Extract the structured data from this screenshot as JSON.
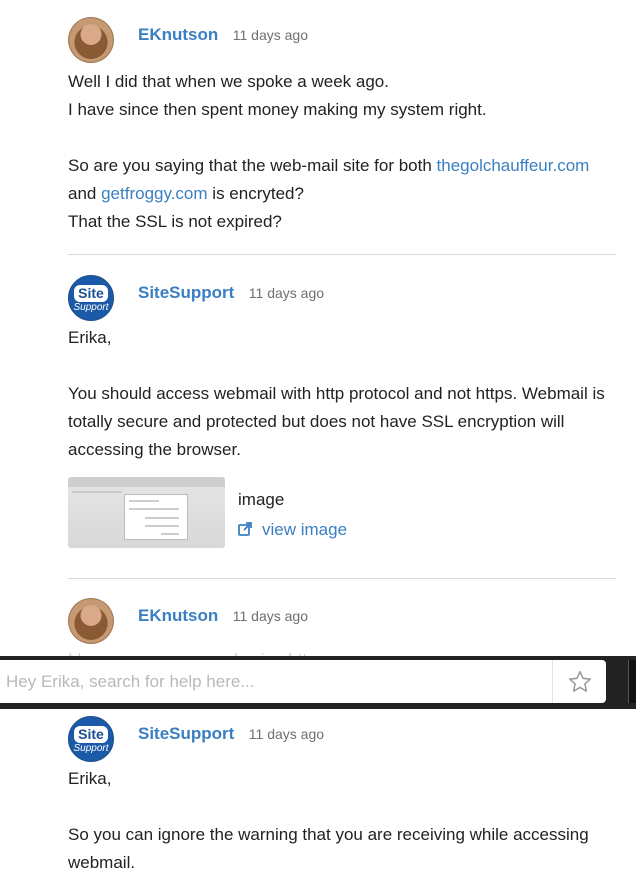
{
  "comments": [
    {
      "author": "EKnutson",
      "time": "11 days ago",
      "avatar": "user-photo",
      "lines": [
        "Well I did that when we spoke a week ago.",
        "I have since then spent money making my system right."
      ],
      "line3_prefix": "So are you saying that the web-mail site for both ",
      "line3_link": "thegolchauffeur.com",
      "line4_prefix": "and ",
      "line4_link": "getfroggy.com",
      "line4_suffix": " is encryted?",
      "line5": "That the SSL is not expired?"
    },
    {
      "author": "SiteSupport",
      "time": "11 days ago",
      "avatar_top": "Site",
      "avatar_bottom": "Support",
      "greeting": "Erika,",
      "paragraph": "You should access webmail with http protocol and not https. Webmail is totally secure and protected but does not have SSL encryption will accessing the browser.",
      "attachment": {
        "name": "image",
        "view_label": "view image"
      }
    },
    {
      "author": "EKnutson",
      "time": "11 days ago",
      "text": "I have never accessed using https."
    },
    {
      "author": "SiteSupport",
      "time": "11 days ago",
      "avatar_top": "Site",
      "avatar_bottom": "Support",
      "greeting": "Erika,",
      "paragraph": "So you can ignore the warning that you are receiving while accessing webmail."
    }
  ],
  "search": {
    "placeholder": "Hey Erika, search for help here..."
  },
  "icons": {
    "favorite": "star-icon",
    "external": "external-link-icon"
  },
  "colors": {
    "link": "#3a7fc1",
    "author": "#3a7fc1",
    "bar": "#222222"
  }
}
